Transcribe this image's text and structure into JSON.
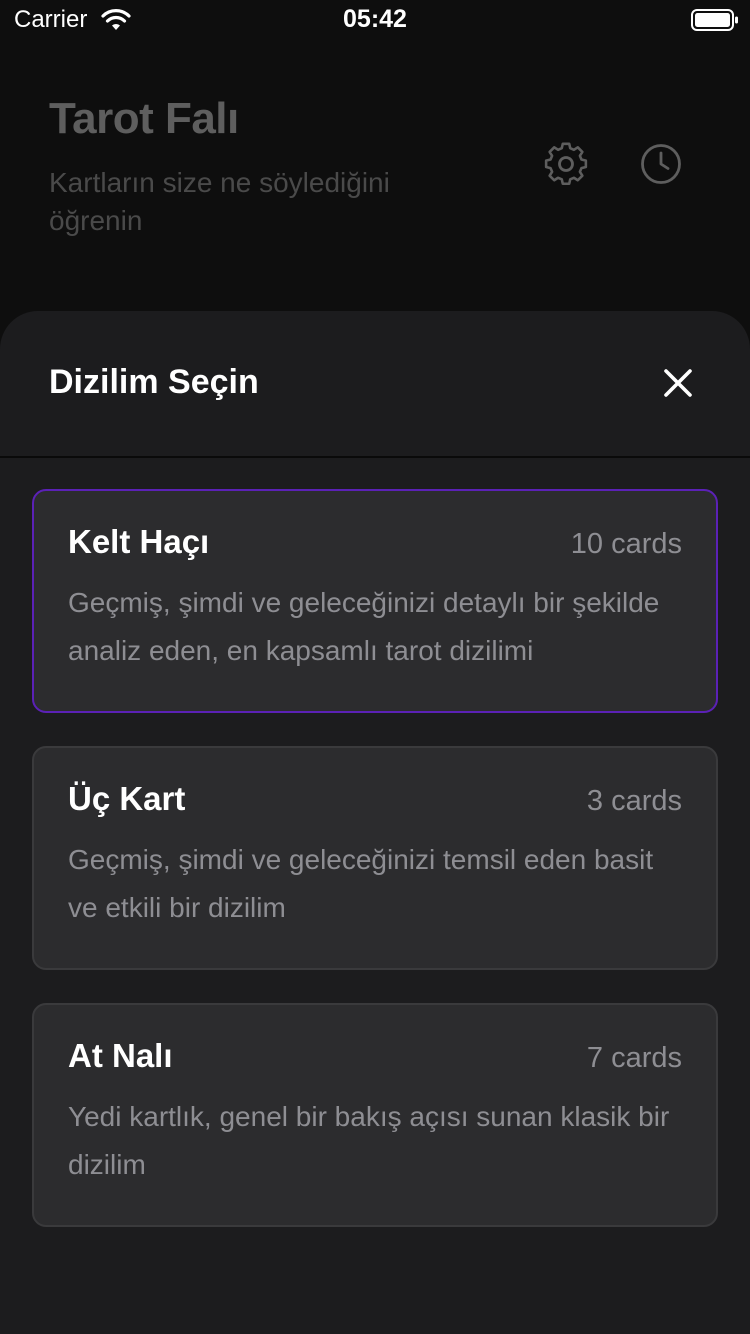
{
  "status_bar": {
    "carrier": "Carrier",
    "time": "05:42"
  },
  "background": {
    "title": "Tarot Falı",
    "subtitle": "Kartların size ne söylediğini öğrenin",
    "icons": [
      "settings-icon",
      "history-icon"
    ]
  },
  "sheet": {
    "title": "Dizilim Seçin",
    "close_icon": "close-icon"
  },
  "spreads": [
    {
      "name": "Kelt Haçı",
      "count": "10 cards",
      "description": "Geçmiş, şimdi ve geleceğinizi detaylı bir şekilde analiz eden, en kapsamlı tarot dizilimi",
      "selected": true
    },
    {
      "name": "Üç Kart",
      "count": "3 cards",
      "description": "Geçmiş, şimdi ve geleceğinizi temsil eden basit ve etkili bir dizilim",
      "selected": false
    },
    {
      "name": "At Nalı",
      "count": "7 cards",
      "description": "Yedi kartlık, genel bir bakış açısı sunan klasik bir dizilim",
      "selected": false
    }
  ],
  "colors": {
    "background": "#0e0e0e",
    "sheet": "#1c1c1e",
    "card": "#2c2c2e",
    "selected_border": "#5b21b6",
    "secondary_text": "#8e8e93"
  }
}
